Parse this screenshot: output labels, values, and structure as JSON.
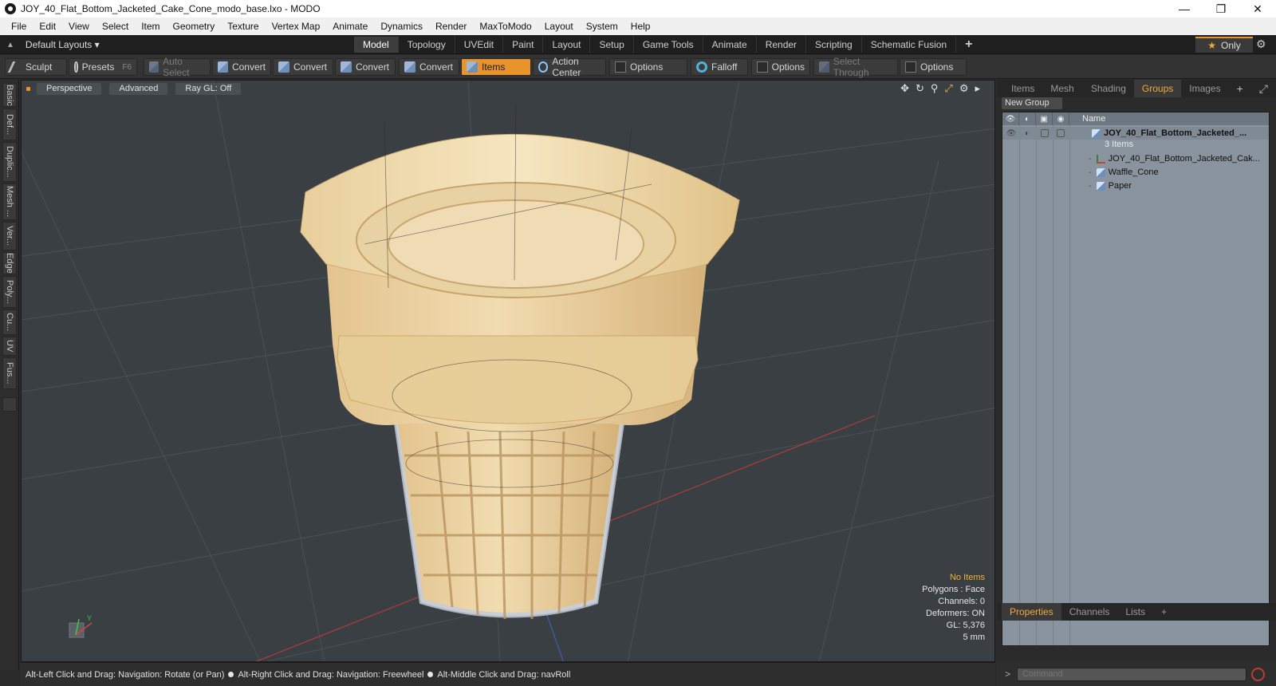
{
  "window": {
    "title": "JOY_40_Flat_Bottom_Jacketed_Cake_Cone_modo_base.lxo - MODO"
  },
  "menu": [
    "File",
    "Edit",
    "View",
    "Select",
    "Item",
    "Geometry",
    "Texture",
    "Vertex Map",
    "Animate",
    "Dynamics",
    "Render",
    "MaxToModo",
    "Layout",
    "System",
    "Help"
  ],
  "layout": {
    "dropdown_label": "Default Layouts ▾",
    "tabs": [
      "Model",
      "Topology",
      "UVEdit",
      "Paint",
      "Layout",
      "Setup",
      "Game Tools",
      "Animate",
      "Render",
      "Scripting",
      "Schematic Fusion"
    ],
    "active_tab": "Model",
    "only_label": "Only"
  },
  "toolbar": {
    "sculpt": "Sculpt",
    "presets": "Presets",
    "presets_key": "F6",
    "auto_select": "Auto Select",
    "convert": "Convert",
    "items": "Items",
    "action_center": "Action Center",
    "options": "Options",
    "falloff": "Falloff",
    "select_through": "Select Through"
  },
  "left_tabs": [
    "Basic",
    "Def...",
    "Duplic...",
    "Mesh ...",
    "Ver...",
    "Edge",
    "Poly...",
    "Cu...",
    "UV",
    "Fus..."
  ],
  "viewport": {
    "view_label": "Perspective",
    "shading_label": "Advanced",
    "raygl_label": "Ray GL: Off",
    "stats": {
      "selection": "No Items",
      "polygons": "Polygons : Face",
      "channels": "Channels: 0",
      "deformers": "Deformers: ON",
      "gl": "GL: 5,376",
      "grid": "5 mm"
    }
  },
  "right_panel": {
    "tabs": [
      "Items",
      "Mesh ...",
      "Shading",
      "Groups",
      "Images"
    ],
    "active_tab": "Groups",
    "new_group": "New Group",
    "column_name": "Name",
    "group": {
      "name": "JOY_40_Flat_Bottom_Jacketed_...",
      "count": "3 Items"
    },
    "children": [
      "JOY_40_Flat_Bottom_Jacketed_Cak...",
      "Waffle_Cone",
      "Paper"
    ],
    "bottom_tabs": [
      "Properties",
      "Channels",
      "Lists"
    ],
    "active_bottom_tab": "Properties"
  },
  "status": {
    "hint1": "Alt-Left Click and Drag: Navigation: Rotate (or Pan)",
    "hint2": "Alt-Right Click and Drag: Navigation: Freewheel",
    "hint3": "Alt-Middle Click and Drag: navRoll"
  },
  "command": {
    "placeholder": "Command"
  }
}
